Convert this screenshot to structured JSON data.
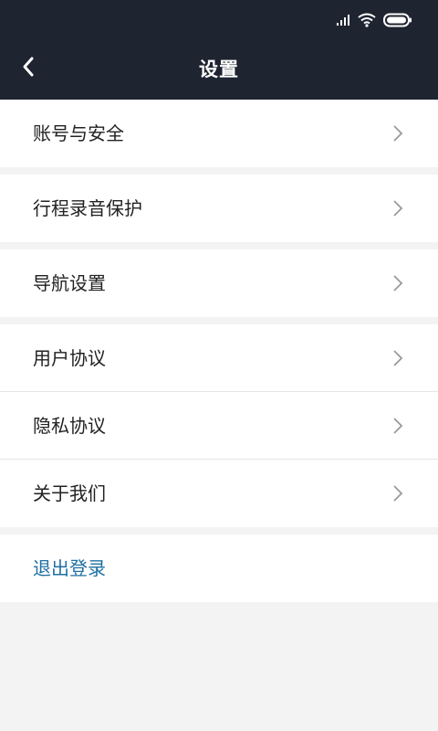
{
  "header": {
    "title": "设置"
  },
  "colors": {
    "header_bg": "#1f2431",
    "page_bg": "#f3f3f3",
    "logout_text": "#1f6fa3"
  },
  "groups": [
    {
      "items": [
        {
          "label": "账号与安全"
        }
      ]
    },
    {
      "items": [
        {
          "label": "行程录音保护"
        }
      ]
    },
    {
      "items": [
        {
          "label": "导航设置"
        }
      ]
    },
    {
      "items": [
        {
          "label": "用户协议"
        },
        {
          "label": "隐私协议"
        },
        {
          "label": "关于我们"
        }
      ]
    }
  ],
  "logout": {
    "label": "退出登录"
  },
  "icons": [
    "signal-icon",
    "wifi-icon",
    "battery-icon",
    "back-arrow-icon",
    "chevron-right-icon"
  ]
}
